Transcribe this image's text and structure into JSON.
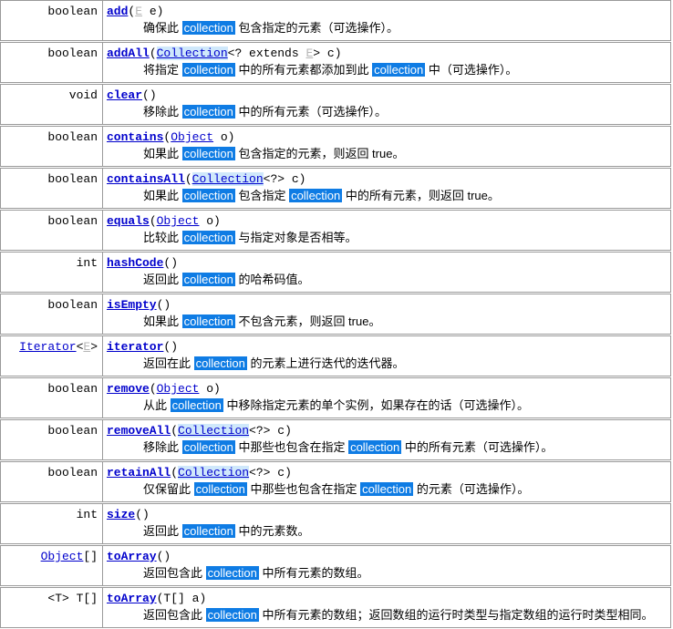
{
  "page": {
    "kind": "javadoc-method-summary",
    "language": "zh-CN",
    "highlight_term": "collection",
    "colors": {
      "link": "#0000cc",
      "link_gray": "#b5b5b5",
      "highlight_bg": "#0f7ce4",
      "highlight_fg": "#ffffff",
      "highlight_link_bg": "#cfe8fb",
      "border": "#9a9a9a",
      "background": "#ffffff"
    }
  },
  "rows": [
    {
      "id": "add",
      "return_type": "boolean",
      "name": "add",
      "signature_open": "(",
      "params": [
        {
          "text": "E",
          "style": "link-gray"
        },
        {
          "text": " e",
          "style": "plain"
        }
      ],
      "signature_close": ")",
      "desc_pre": "确保此 ",
      "desc_hl": "collection",
      "desc_post": " 包含指定的元素（可选操作）。"
    },
    {
      "id": "addAll",
      "return_type": "boolean",
      "name": "addAll",
      "signature_open": "(",
      "params": [
        {
          "text": "Collection",
          "style": "link-highlight"
        },
        {
          "text": "<? extends ",
          "style": "plain"
        },
        {
          "text": "E",
          "style": "link-gray"
        },
        {
          "text": "> c",
          "style": "plain"
        }
      ],
      "signature_close": ")",
      "desc_pre": "将指定 ",
      "desc_hl": "collection",
      "desc_mid": " 中的所有元素都添加到此 ",
      "desc_hl2": "collection",
      "desc_post": " 中（可选操作）。"
    },
    {
      "id": "clear",
      "return_type": "void",
      "name": "clear",
      "signature_open": "(",
      "params": [],
      "signature_close": ")",
      "desc_pre": "移除此 ",
      "desc_hl": "collection",
      "desc_post": " 中的所有元素（可选操作）。"
    },
    {
      "id": "contains",
      "return_type": "boolean",
      "name": "contains",
      "signature_open": "(",
      "params": [
        {
          "text": "Object",
          "style": "link"
        },
        {
          "text": " o",
          "style": "plain"
        }
      ],
      "signature_close": ")",
      "desc_pre": "如果此 ",
      "desc_hl": "collection",
      "desc_post": " 包含指定的元素，则返回 true。"
    },
    {
      "id": "containsAll",
      "return_type": "boolean",
      "name": "containsAll",
      "signature_open": "(",
      "params": [
        {
          "text": "Collection",
          "style": "link-highlight"
        },
        {
          "text": "<?> c",
          "style": "plain"
        }
      ],
      "signature_close": ")",
      "desc_pre": "如果此 ",
      "desc_hl": "collection",
      "desc_mid": " 包含指定 ",
      "desc_hl2": "collection",
      "desc_post": " 中的所有元素，则返回 true。"
    },
    {
      "id": "equals",
      "return_type": "boolean",
      "name": "equals",
      "signature_open": "(",
      "params": [
        {
          "text": "Object",
          "style": "link"
        },
        {
          "text": " o",
          "style": "plain"
        }
      ],
      "signature_close": ")",
      "desc_pre": "比较此 ",
      "desc_hl": "collection",
      "desc_post": " 与指定对象是否相等。"
    },
    {
      "id": "hashCode",
      "return_type": "int",
      "name": "hashCode",
      "signature_open": "(",
      "params": [],
      "signature_close": ")",
      "desc_pre": "返回此 ",
      "desc_hl": "collection",
      "desc_post": " 的哈希码值。"
    },
    {
      "id": "isEmpty",
      "return_type": "boolean",
      "name": "isEmpty",
      "signature_open": "(",
      "params": [],
      "signature_close": ")",
      "desc_pre": "如果此 ",
      "desc_hl": "collection",
      "desc_post": " 不包含元素，则返回 true。"
    },
    {
      "id": "iterator",
      "return_type_parts": [
        {
          "text": "Iterator",
          "style": "link"
        },
        {
          "text": "<",
          "style": "plain"
        },
        {
          "text": "E",
          "style": "link-gray"
        },
        {
          "text": ">",
          "style": "plain"
        }
      ],
      "return_type": "Iterator<E>",
      "name": "iterator",
      "signature_open": "(",
      "params": [],
      "signature_close": ")",
      "desc_pre": "返回在此 ",
      "desc_hl": "collection",
      "desc_post": " 的元素上进行迭代的迭代器。"
    },
    {
      "id": "remove",
      "return_type": "boolean",
      "name": "remove",
      "signature_open": "(",
      "params": [
        {
          "text": "Object",
          "style": "link"
        },
        {
          "text": " o",
          "style": "plain"
        }
      ],
      "signature_close": ")",
      "desc_pre": "从此 ",
      "desc_hl": "collection",
      "desc_post": " 中移除指定元素的单个实例，如果存在的话（可选操作）。"
    },
    {
      "id": "removeAll",
      "return_type": "boolean",
      "name": "removeAll",
      "signature_open": "(",
      "params": [
        {
          "text": "Collection",
          "style": "link-highlight"
        },
        {
          "text": "<?> c",
          "style": "plain"
        }
      ],
      "signature_close": ")",
      "desc_pre": "移除此 ",
      "desc_hl": "collection",
      "desc_mid": " 中那些也包含在指定 ",
      "desc_hl2": "collection",
      "desc_post": " 中的所有元素（可选操作）。"
    },
    {
      "id": "retainAll",
      "return_type": "boolean",
      "name": "retainAll",
      "signature_open": "(",
      "params": [
        {
          "text": "Collection",
          "style": "link-highlight"
        },
        {
          "text": "<?> c",
          "style": "plain"
        }
      ],
      "signature_close": ")",
      "desc_pre": "仅保留此 ",
      "desc_hl": "collection",
      "desc_mid": " 中那些也包含在指定 ",
      "desc_hl2": "collection",
      "desc_post": " 的元素（可选操作）。"
    },
    {
      "id": "size",
      "return_type": "int",
      "name": "size",
      "signature_open": "(",
      "params": [],
      "signature_close": ")",
      "desc_pre": "返回此 ",
      "desc_hl": "collection",
      "desc_post": " 中的元素数。"
    },
    {
      "id": "toArray",
      "return_type_parts": [
        {
          "text": "Object",
          "style": "link"
        },
        {
          "text": "[]",
          "style": "plain"
        }
      ],
      "return_type": "Object[]",
      "name": "toArray",
      "signature_open": "(",
      "params": [],
      "signature_close": ")",
      "desc_pre": "返回包含此 ",
      "desc_hl": "collection",
      "desc_post": " 中所有元素的数组。"
    },
    {
      "id": "toArray-generic",
      "return_type": "<T> T[]",
      "name": "toArray",
      "signature_open": "(",
      "params": [
        {
          "text": "T[] a",
          "style": "plain"
        }
      ],
      "signature_close": ")",
      "desc_pre": "返回包含此 ",
      "desc_hl": "collection",
      "desc_post": " 中所有元素的数组；返回数组的运行时类型与指定数组的运行时类型相同。"
    }
  ]
}
